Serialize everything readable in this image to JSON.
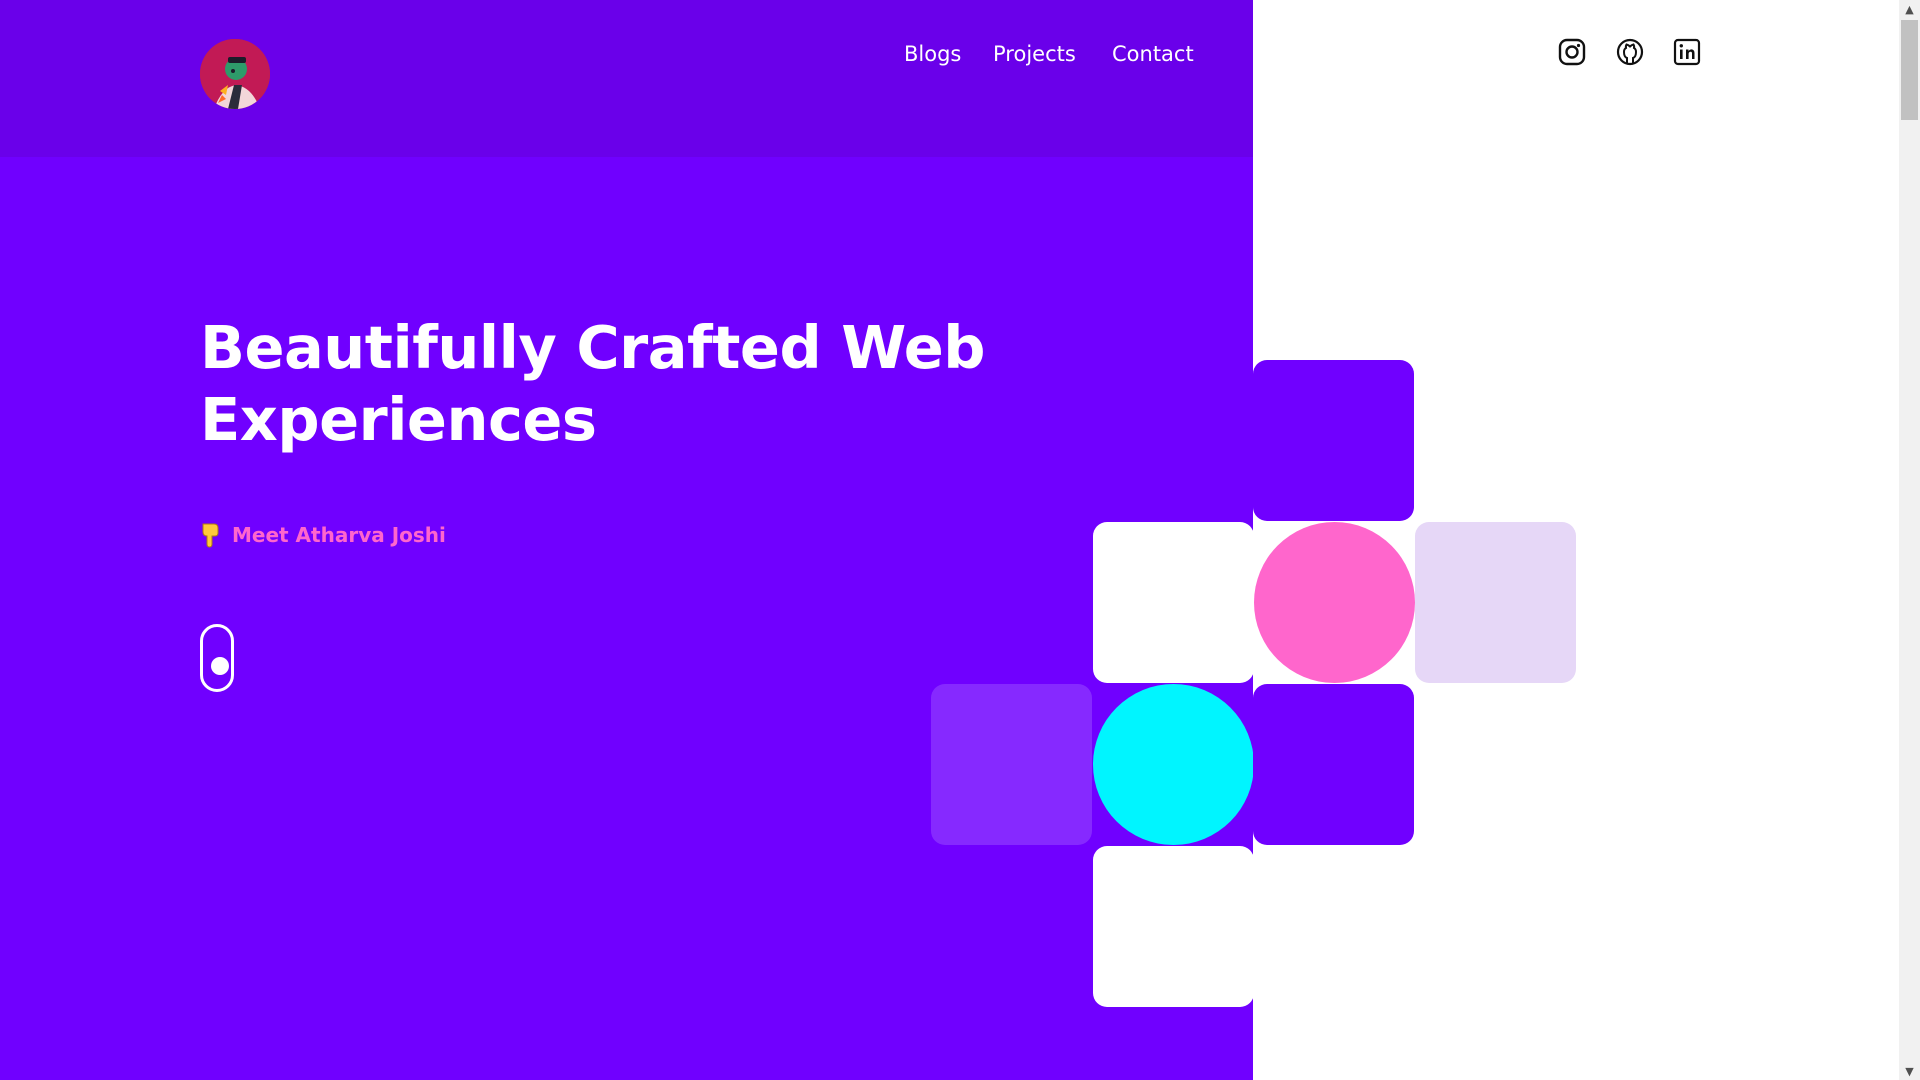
{
  "colors": {
    "primary": "#7000ff",
    "header_bar": "#6a00ea",
    "accent_pink": "#ff66cc",
    "accent_cyan": "#00f5ff",
    "light_purple": "#e6d7f7",
    "mid_purple": "#8629ff",
    "white": "#ffffff"
  },
  "nav": {
    "items": [
      {
        "label": "Blogs"
      },
      {
        "label": "Projects"
      },
      {
        "label": "Contact"
      }
    ]
  },
  "social": [
    {
      "icon": "instagram-icon"
    },
    {
      "icon": "github-icon"
    },
    {
      "icon": "linkedin-icon"
    }
  ],
  "hero": {
    "title": "Beautifully Crafted Web Experiences",
    "meet_label": "Meet Atharva Joshi",
    "meet_icon": "pointing-down-hand-icon"
  },
  "scrollbar": {
    "up_arrow": "▲",
    "down_arrow": "▼"
  }
}
